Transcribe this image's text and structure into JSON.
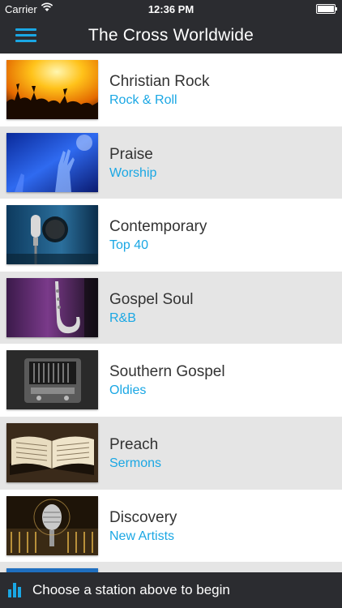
{
  "status_bar": {
    "carrier": "Carrier",
    "time": "12:36 PM"
  },
  "header": {
    "title": "The Cross Worldwide",
    "menu_icon": "hamburger-menu-icon"
  },
  "stations": [
    {
      "name": "Christian Rock",
      "genre": "Rock & Roll",
      "image": "concert-crowd-image"
    },
    {
      "name": "Praise",
      "genre": "Worship",
      "image": "worship-hands-image"
    },
    {
      "name": "Contemporary",
      "genre": "Top 40",
      "image": "studio-microphone-image"
    },
    {
      "name": "Gospel Soul",
      "genre": "R&B",
      "image": "saxophone-image"
    },
    {
      "name": "Southern Gospel",
      "genre": "Oldies",
      "image": "vintage-radio-image"
    },
    {
      "name": "Preach",
      "genre": "Sermons",
      "image": "open-bible-image"
    },
    {
      "name": "Discovery",
      "genre": "New Artists",
      "image": "mixing-board-microphone-image"
    }
  ],
  "footer": {
    "message": "Choose a station above to begin",
    "icon": "equalizer-icon"
  },
  "colors": {
    "accent": "#1aa7e4",
    "bar": "#2b2c30",
    "alt_row": "#e5e5e5"
  }
}
